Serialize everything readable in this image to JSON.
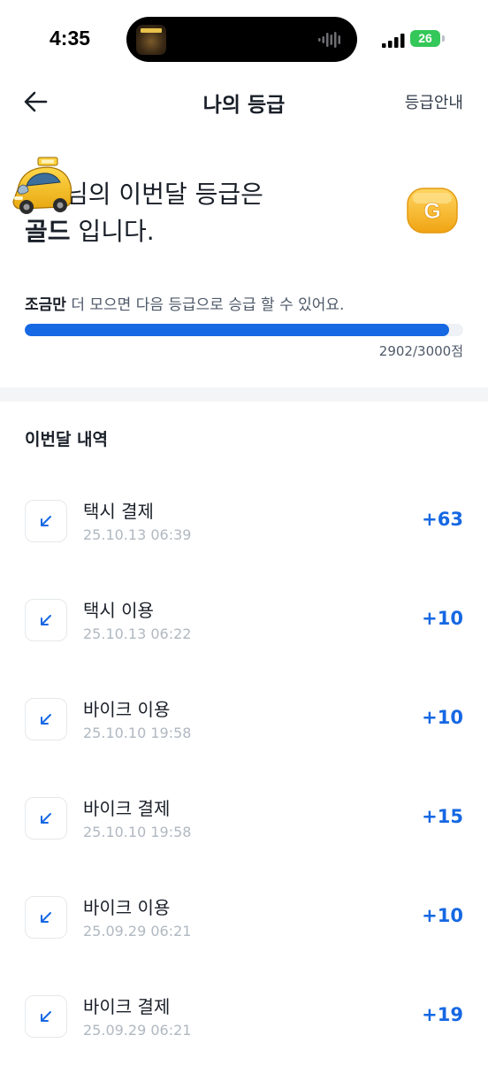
{
  "status_bar": {
    "time": "4:35",
    "battery": "26"
  },
  "header": {
    "title": "나의 등급",
    "guide_link": "등급안내"
  },
  "summary": {
    "grade_line1": "님의 이번달 등급은",
    "grade_name": "골드",
    "grade_suffix": " 입니다.",
    "badge_letter": "G",
    "progress_emphasis": "조금만",
    "progress_rest": " 더 모으면 다음 등급으로 승급 할 수 있어요.",
    "progress_count": "2902/3000점",
    "progress_fraction": 0.9673
  },
  "history": {
    "title": "이번달 내역",
    "items": [
      {
        "title": "택시 결제",
        "date": "25.10.13 06:39",
        "points": "+63"
      },
      {
        "title": "택시 이용",
        "date": "25.10.13 06:22",
        "points": "+10"
      },
      {
        "title": "바이크 이용",
        "date": "25.10.10 19:58",
        "points": "+10"
      },
      {
        "title": "바이크 결제",
        "date": "25.10.10 19:58",
        "points": "+15"
      },
      {
        "title": "바이크 이용",
        "date": "25.09.29 06:21",
        "points": "+10"
      },
      {
        "title": "바이크 결제",
        "date": "25.09.29 06:21",
        "points": "+19"
      }
    ]
  },
  "colors": {
    "accent": "#1668e3",
    "text_primary": "#191f28",
    "text_secondary": "#b0b8c1",
    "gold": "#f5b81f",
    "battery": "#34c759"
  },
  "icons": {
    "back": "arrow-left-icon",
    "row": "arrow-down-left-icon",
    "avatar": "taxi-icon",
    "grade": "gold-badge-icon"
  }
}
